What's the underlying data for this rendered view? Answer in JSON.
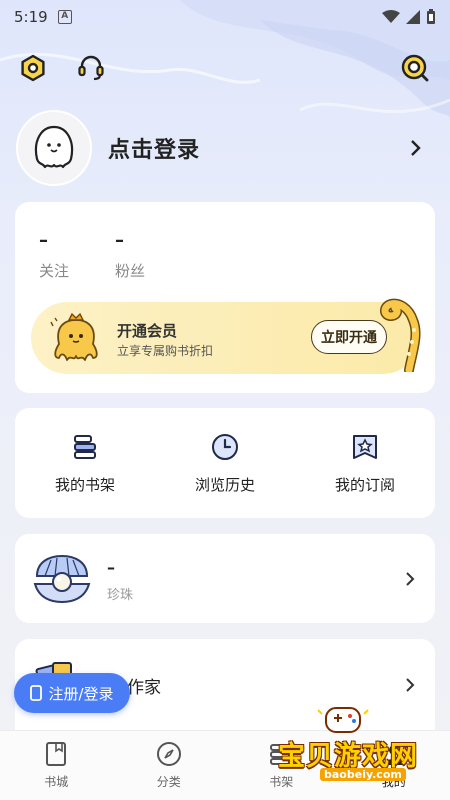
{
  "status_bar": {
    "time": "5:19",
    "notification_badge": "A"
  },
  "profile": {
    "login_text": "点击登录"
  },
  "stats": [
    {
      "value": "–",
      "label": "关注"
    },
    {
      "value": "–",
      "label": "粉丝"
    }
  ],
  "vip": {
    "title": "开通会员",
    "subtitle": "立享专属购书折扣",
    "button": "立即开通"
  },
  "quick_actions": [
    {
      "label": "我的书架",
      "icon": "bookshelf-icon"
    },
    {
      "label": "浏览历史",
      "icon": "clock-icon"
    },
    {
      "label": "我的订阅",
      "icon": "subscription-icon"
    }
  ],
  "pearl": {
    "value": "–",
    "label": "珍珠"
  },
  "author": {
    "label": "作家"
  },
  "float_button": {
    "label": "注册/登录"
  },
  "bottom_nav": [
    {
      "label": "书城",
      "icon": "book-icon"
    },
    {
      "label": "分类",
      "icon": "compass-icon"
    },
    {
      "label": "书架",
      "icon": "bookshelf-icon"
    },
    {
      "label": "我的",
      "icon": "profile-icon"
    }
  ],
  "watermark": {
    "text": "宝贝游戏网",
    "url": "baobeiy.com"
  },
  "colors": {
    "accent_blue": "#4a7cf6",
    "vip_gold": "#fbeaa8",
    "octopus_yellow": "#f7c84a"
  }
}
